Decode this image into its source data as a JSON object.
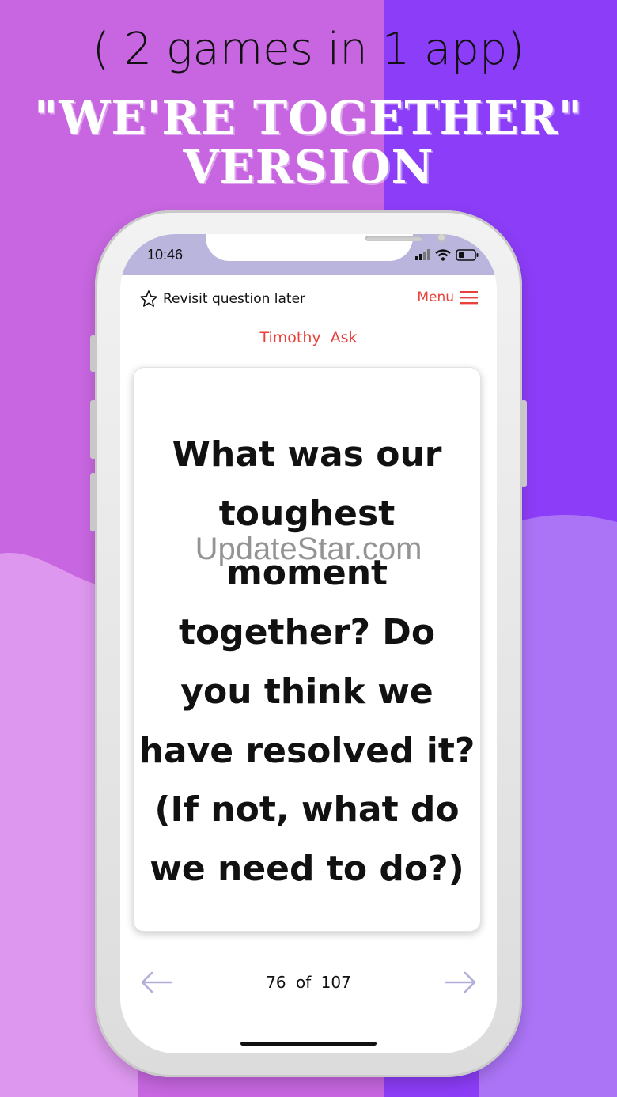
{
  "promo": {
    "tagline": "( 2 games in 1 app)",
    "headline_line1": "\"WE'RE TOGETHER\"",
    "headline_line2": "VERSION"
  },
  "status_bar": {
    "time": "10:46",
    "icons": [
      "signal-icon",
      "wifi-icon",
      "battery-icon"
    ]
  },
  "toolbar": {
    "revisit_label": "Revisit question later",
    "menu_label": "Menu"
  },
  "asker": "Timothy  Ask",
  "card": {
    "question_lines": [
      "What was our",
      "toughest moment",
      "together? Do",
      "you think we",
      "have resolved it?"
    ],
    "followup_lines": [
      "(If not, what do",
      "we need to do?)"
    ]
  },
  "pager": {
    "counter": "76 of  107"
  },
  "watermark": "UpdateStar.com",
  "colors": {
    "accent_red": "#e8403a",
    "bg_pink": "#c766e0",
    "bg_purple": "#8c3df7",
    "status_bar": "#b9b5dd",
    "arrow": "#b2aedc"
  }
}
